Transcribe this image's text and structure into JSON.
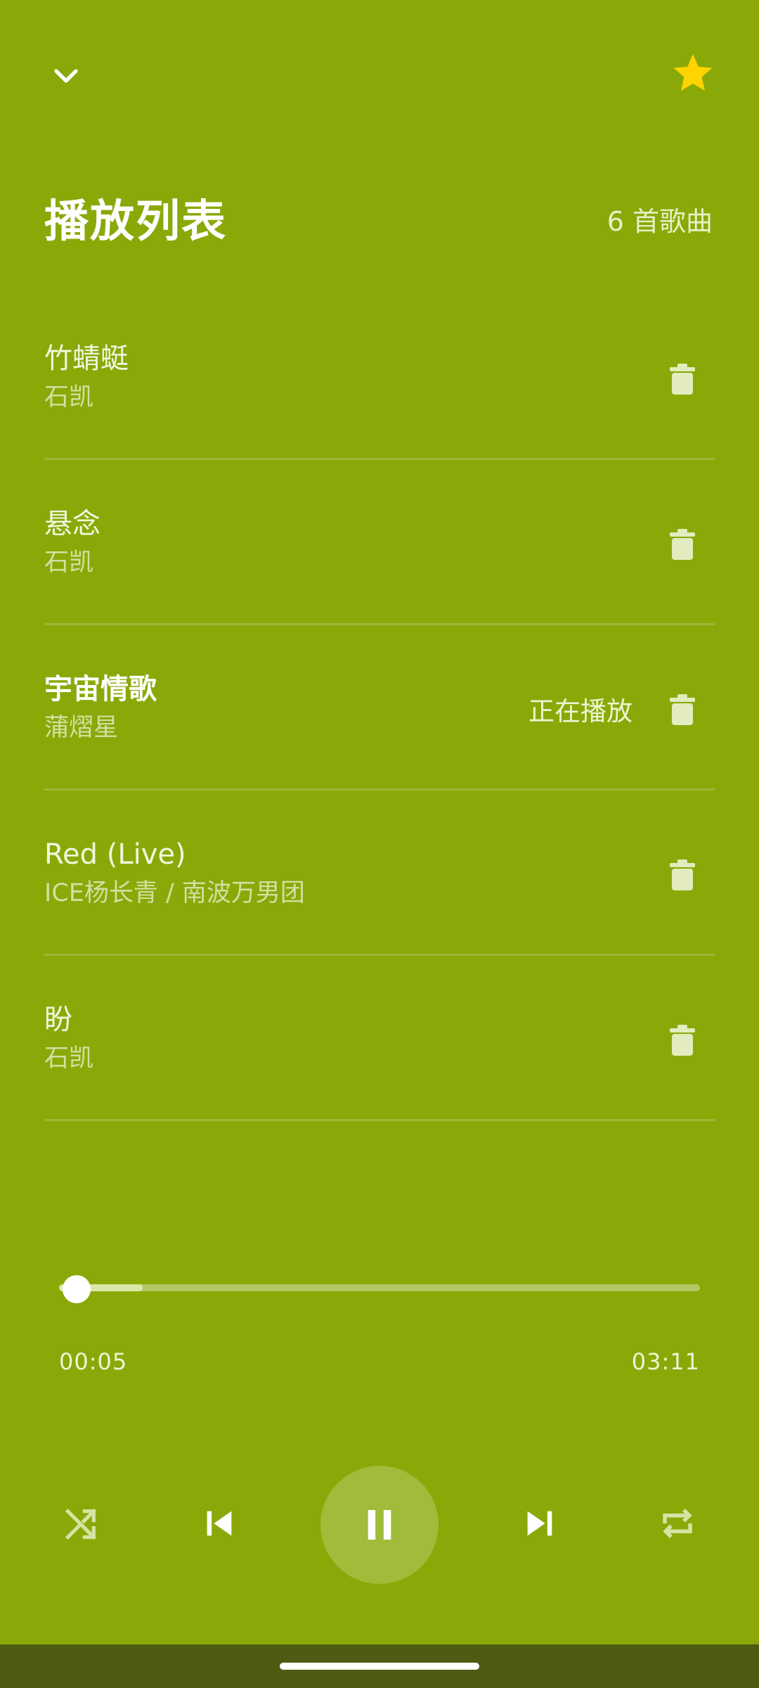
{
  "header": {
    "collapse_icon": "chevron-down-icon",
    "favorite_icon": "star-icon",
    "favorite_color": "#ffd400"
  },
  "playlist": {
    "title": "播放列表",
    "count": "6 首歌曲",
    "now_playing_label": "正在播放",
    "items": [
      {
        "title": "竹蜻蜓",
        "artist": "石凯",
        "current": false
      },
      {
        "title": "悬念",
        "artist": "石凯",
        "current": false
      },
      {
        "title": "宇宙情歌",
        "artist": "蒲熠星",
        "current": true
      },
      {
        "title": "Red (Live)",
        "artist": "ICE杨长青 / 南波万男团",
        "current": false
      },
      {
        "title": "盼",
        "artist": "石凯",
        "current": false
      }
    ]
  },
  "player": {
    "elapsed": "00:05",
    "total": "03:11",
    "position_fraction": 0.027,
    "buffered_fraction": 0.13,
    "controls": [
      "shuffle-icon",
      "previous-icon",
      "pause-icon",
      "next-icon",
      "repeat-icon"
    ]
  },
  "colors": {
    "background": "#8aa909",
    "accent_star": "#ffd400"
  }
}
